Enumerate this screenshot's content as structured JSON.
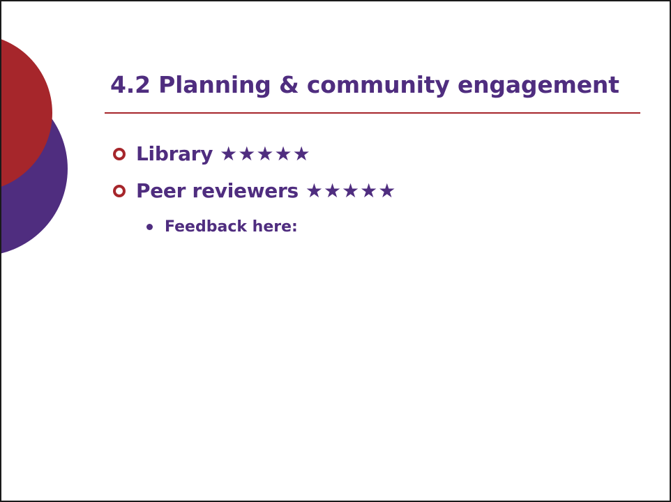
{
  "colors": {
    "accent_red": "#a6262b",
    "accent_purple": "#4f2d7f"
  },
  "slide": {
    "title": "4.2 Planning & community engagement",
    "items": [
      {
        "label": "Library",
        "stars": "★★★★★",
        "rating": 5,
        "max_rating": 5
      },
      {
        "label": "Peer reviewers",
        "stars": "★★★★★",
        "rating": 5,
        "max_rating": 5
      }
    ],
    "sub_items": [
      {
        "label": "Feedback here:"
      }
    ]
  }
}
